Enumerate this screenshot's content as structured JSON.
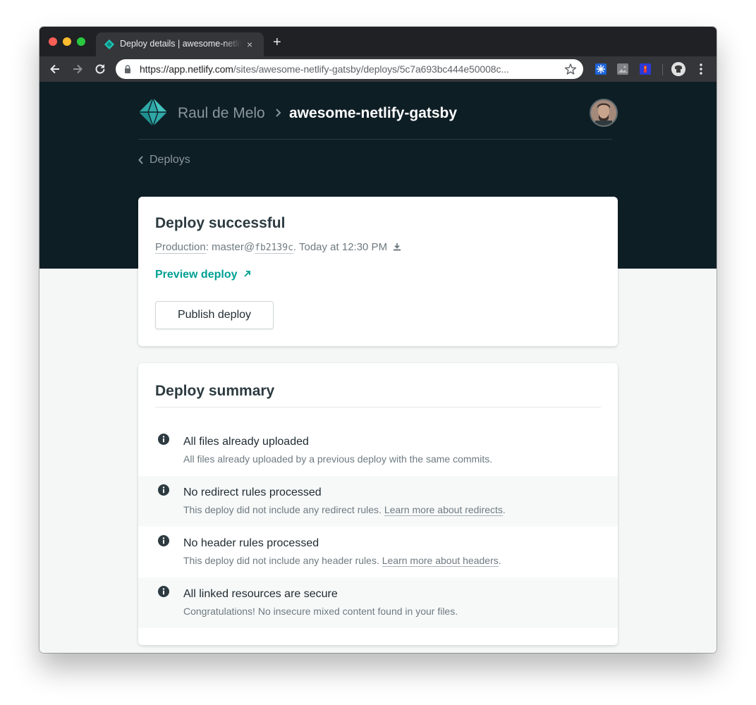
{
  "browser": {
    "tab_title": "Deploy details | awesome-netlify-gatsby",
    "tab_close": "×",
    "new_tab": "+",
    "url_host": "https://app.netlify.com",
    "url_path": "/sites/awesome-netlify-gatsby/deploys/5c7a693bc444e50008c...",
    "accent": "#00a093"
  },
  "header": {
    "team": "Raul de Melo",
    "site": "awesome-netlify-gatsby",
    "back_label": "Deploys"
  },
  "deploy": {
    "title": "Deploy successful",
    "context": "Production",
    "branch_prefix": ": master@",
    "sha": "fb2139c",
    "time": ". Today at 12:30 PM",
    "preview_label": "Preview deploy",
    "publish_label": "Publish deploy"
  },
  "summary": {
    "title": "Deploy summary",
    "items": [
      {
        "title": "All files already uploaded",
        "desc": "All files already uploaded by a previous deploy with the same commits.",
        "link": "",
        "after": ""
      },
      {
        "title": "No redirect rules processed",
        "desc": "This deploy did not include any redirect rules. ",
        "link": "Learn more about redirects",
        "after": "."
      },
      {
        "title": "No header rules processed",
        "desc": "This deploy did not include any header rules. ",
        "link": "Learn more about headers",
        "after": "."
      },
      {
        "title": "All linked resources are secure",
        "desc": "Congratulations! No insecure mixed content found in your files.",
        "link": "",
        "after": ""
      }
    ]
  }
}
